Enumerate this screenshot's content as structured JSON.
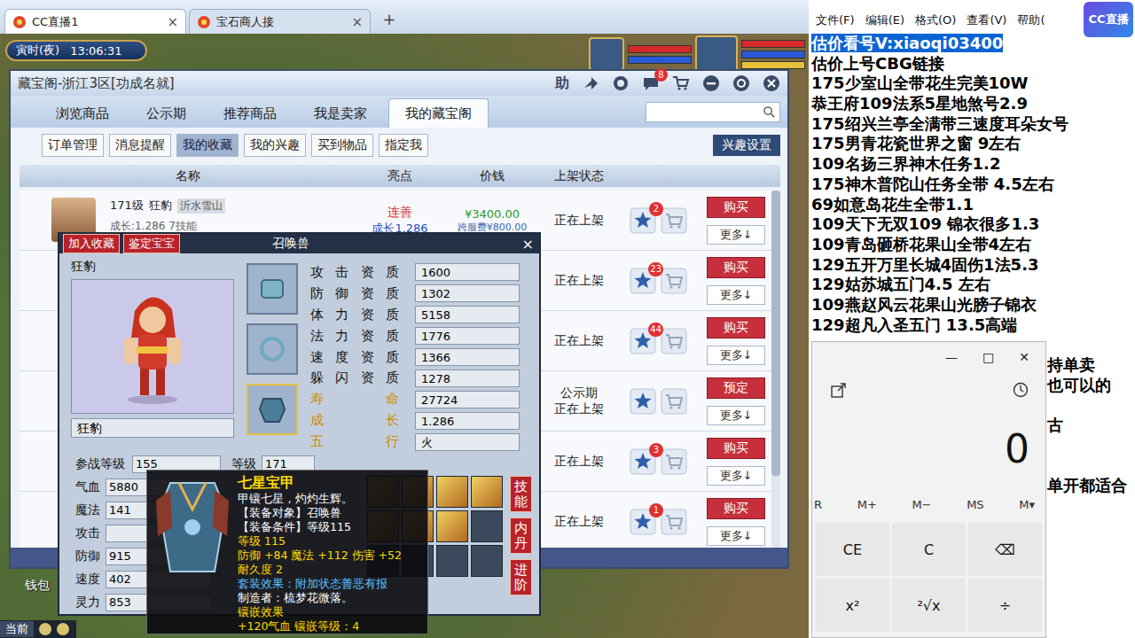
{
  "browser": {
    "tabs": [
      {
        "label": "CC直播1",
        "close": "×",
        "selected": true
      },
      {
        "label": "宝石商人接",
        "close": "×",
        "selected": false
      }
    ],
    "new_tab": "+"
  },
  "game": {
    "period": "寅时(夜)",
    "clock": "13:06:31",
    "wallet": "钱包",
    "channel": "当前"
  },
  "cbg": {
    "title": "藏宝阁-浙江3区[功成名就]",
    "help": "助",
    "message_count": "8",
    "tabs": [
      {
        "label": "浏览商品",
        "selected": false
      },
      {
        "label": "公示期",
        "selected": false
      },
      {
        "label": "推荐商品",
        "selected": false
      },
      {
        "label": "我是卖家",
        "selected": false
      },
      {
        "label": "我的藏宝阁",
        "selected": true
      }
    ],
    "subtabs": [
      {
        "label": "订单管理",
        "selected": false
      },
      {
        "label": "消息提醒",
        "selected": false
      },
      {
        "label": "我的收藏",
        "selected": true
      },
      {
        "label": "我的兴趣",
        "selected": false
      },
      {
        "label": "买到物品",
        "selected": false
      },
      {
        "label": "指定我",
        "selected": false
      }
    ],
    "interest_button": "兴趣设置",
    "columns": [
      "名称",
      "亮点",
      "价钱",
      "上架状态"
    ],
    "first_item": {
      "level": "171级",
      "name": "狂豹",
      "server": "沂水雪山",
      "detail": "成长:1.286  7技能",
      "highlights": [
        "连善",
        "成长1.286"
      ],
      "price": "¥3400.00",
      "fee": "跨服费¥800.00"
    },
    "rows": [
      {
        "status": [
          "正在上架"
        ],
        "count": "2",
        "action": "购买",
        "more": "更多↓"
      },
      {
        "status": [
          "正在上架"
        ],
        "count": "23",
        "action": "购买",
        "more": "更多↓"
      },
      {
        "status": [
          "正在上架"
        ],
        "count": "44",
        "action": "购买",
        "more": "更多↓"
      },
      {
        "status": [
          "公示期",
          "正在上架"
        ],
        "count": "",
        "action": "预定",
        "more": "更多↓"
      },
      {
        "status": [
          "正在上架"
        ],
        "count": "3",
        "action": "购买",
        "more": "更多↓"
      },
      {
        "status": [
          "正在上架"
        ],
        "count": "1",
        "action": "购买",
        "more": "更多↓"
      }
    ]
  },
  "pet": {
    "buttons": [
      "加入收藏",
      "鉴定宝宝"
    ],
    "title": "召唤兽",
    "close": "×",
    "name": "狂豹",
    "nickname": "狂豹",
    "equipment": [
      {
        "selected": false
      },
      {
        "selected": false
      },
      {
        "selected": true
      }
    ],
    "aptitudes": [
      {
        "label": "攻击资质",
        "value": "1600",
        "highlight": false
      },
      {
        "label": "防御资质",
        "value": "1302",
        "highlight": false
      },
      {
        "label": "体力资质",
        "value": "5158",
        "highlight": false
      },
      {
        "label": "法力资质",
        "value": "1776",
        "highlight": false
      },
      {
        "label": "速度资质",
        "value": "1366",
        "highlight": false
      },
      {
        "label": "躲闪资质",
        "value": "1278",
        "highlight": false
      },
      {
        "label": "寿命",
        "value": "27724",
        "highlight": true
      },
      {
        "label": "成长",
        "value": "1.286",
        "highlight": true
      },
      {
        "label": "五行",
        "value": "火",
        "highlight": true
      }
    ],
    "level_label": "参战等级",
    "level_value": "155",
    "grade_label": "等级",
    "grade_value": "171",
    "attributes": [
      {
        "label": "气血",
        "value": "5880"
      },
      {
        "label": "魔法",
        "value": "141"
      },
      {
        "label": "攻击",
        "value": ""
      },
      {
        "label": "防御",
        "value": "915"
      },
      {
        "label": "速度",
        "value": "402"
      },
      {
        "label": "灵力",
        "value": "853"
      }
    ],
    "side_buttons": [
      "技能",
      "内丹",
      "进阶"
    ],
    "skills": [
      {
        "filled": true
      },
      {
        "filled": true
      },
      {
        "filled": true
      },
      {
        "filled": true
      },
      {
        "filled": true
      },
      {
        "filled": true
      },
      {
        "filled": true
      },
      {
        "filled": false
      },
      {
        "filled": false
      },
      {
        "filled": false
      },
      {
        "filled": false
      },
      {
        "filled": false
      }
    ]
  },
  "tooltip": {
    "title": "七星宝甲",
    "lines": [
      {
        "text": "甲镶七星，灼灼生辉。",
        "color": "#ffffff"
      },
      {
        "text": "【装备对象】召唤兽",
        "color": "#ffffff"
      },
      {
        "text": "【装备条件】等级115",
        "color": "#ffffff"
      },
      {
        "text": "等级 115",
        "color": "#ffd800"
      },
      {
        "text": "防御 +84 魔法 +112 伤害 +52",
        "color": "#ffd800"
      },
      {
        "text": "耐久度 2",
        "color": "#ffd800"
      },
      {
        "text": "套装效果：附加状态善恶有报",
        "color": "#5cc0ff"
      },
      {
        "text": "制造者：梳梦花微落。",
        "color": "#ffffff"
      },
      {
        "text": "镶嵌效果",
        "color": "#ffd800"
      },
      {
        "text": "+120气血 镶嵌等级：4",
        "color": "#ffd800"
      }
    ]
  },
  "notepad": {
    "menu": [
      "文件(F)",
      "编辑(E)",
      "格式(O)",
      "查看(V)",
      "帮助("
    ],
    "lines": [
      {
        "text": "估价看号V:xiaoqi03400",
        "selected": true
      },
      {
        "text": "估价上号CBG链接",
        "selected": false
      },
      {
        "text": "175少室山全带花生完美10W",
        "selected": false
      },
      {
        "text": "恭王府109法系5星地煞号2.9",
        "selected": false
      },
      {
        "text": "175绍兴兰亭全满带三速度耳朵女号",
        "selected": false
      },
      {
        "text": "175男青花瓷世界之窗  9左右",
        "selected": false
      },
      {
        "text": "109名扬三界神木任务1.2",
        "selected": false
      },
      {
        "text": "175神木普陀山任务全带 4.5左右",
        "selected": false
      },
      {
        "text": "69如意岛花生全带1.1",
        "selected": false
      },
      {
        "text": "109天下无双109  锦衣很多1.3",
        "selected": false
      },
      {
        "text": "109青岛砸桥花果山全带4左右",
        "selected": false
      },
      {
        "text": "129五开万里长城4固伤1法5.3",
        "selected": false
      },
      {
        "text": "129姑苏城五门4.5  左右",
        "selected": false
      },
      {
        "text": "109燕赵风云花果山光膀子锦衣",
        "selected": false
      },
      {
        "text": "129超凡入圣五门  13.5高端",
        "selected": false
      }
    ],
    "tails": [
      "",
      "持单卖",
      "也可以的",
      "",
      "古",
      "",
      "",
      "单开都适合"
    ]
  },
  "calculator": {
    "title_buttons": [
      "—",
      "□",
      "✕"
    ],
    "display": "0",
    "memory": [
      "R",
      "M+",
      "M−",
      "MS",
      "M▾"
    ],
    "keys": [
      "CE",
      "C",
      "⌫",
      "x²",
      "²√x",
      "÷"
    ]
  },
  "cc_logo": "CC直播"
}
